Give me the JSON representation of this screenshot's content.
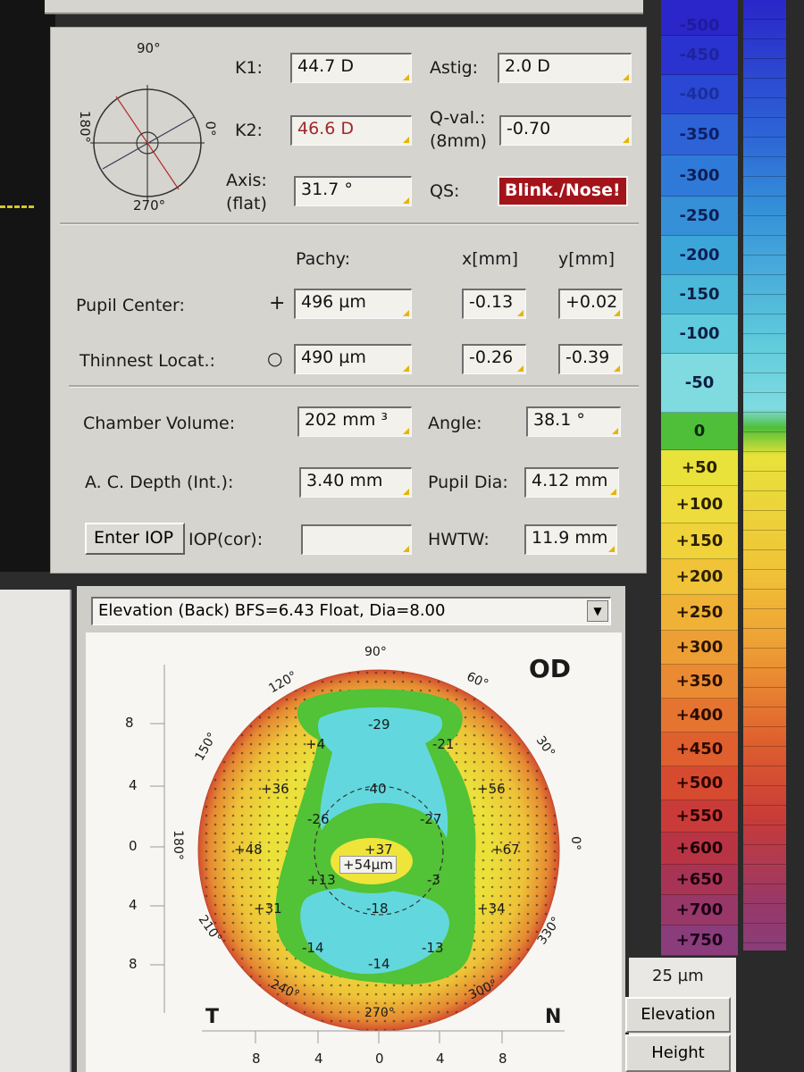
{
  "keratometry": {
    "k1_label": "K1:",
    "k1_value": "44.7 D",
    "k2_label": "K2:",
    "k2_value": "46.6 D",
    "axis_label_1": "Axis:",
    "axis_label_2": "(flat)",
    "axis_value": "31.7 °",
    "astig_label": "Astig:",
    "astig_value": "2.0 D",
    "qval_label_1": "Q-val.:",
    "qval_label_2": "(8mm)",
    "qval_value": "-0.70",
    "qs_label": "QS:",
    "qs_value": "Blink./Nose!",
    "dial_90": "90°",
    "dial_180": "180°",
    "dial_0": "0°",
    "dial_270": "270°"
  },
  "pachy": {
    "header_pachy": "Pachy:",
    "header_x": "x[mm]",
    "header_y": "y[mm]",
    "pupil_label": "Pupil Center:",
    "pupil_marker": "+",
    "pupil_pachy": "496 µm",
    "pupil_x": "-0.13",
    "pupil_y": "+0.02",
    "thin_label": "Thinnest Locat.:",
    "thin_marker": "○",
    "thin_pachy": "490 µm",
    "thin_x": "-0.26",
    "thin_y": "-0.39"
  },
  "chamber": {
    "volume_label": "Chamber Volume:",
    "volume_value": "202 mm ³",
    "angle_label": "Angle:",
    "angle_value": "38.1 °",
    "depth_label": "A. C. Depth (Int.):",
    "depth_value": "3.40 mm",
    "pupil_dia_label": "Pupil Dia:",
    "pupil_dia_value": "4.12 mm",
    "enter_iop": "Enter IOP",
    "iop_cor_label": "IOP(cor):",
    "iop_cor_value": "",
    "hwtw_label": "HWTW:",
    "hwtw_value": "11.9 mm"
  },
  "map": {
    "dropdown_value": "Elevation (Back)  BFS=6.43 Float, Dia=8.00",
    "eye": "OD",
    "temporal": "T",
    "nasal": "N",
    "angle_labels": [
      "90°",
      "60°",
      "30°",
      "0°",
      "330°",
      "300°",
      "270°",
      "240°",
      "210°",
      "180°",
      "150°",
      "120°"
    ],
    "y_ticks": [
      "8",
      "4",
      "0",
      "4",
      "8"
    ],
    "x_ticks": [
      "8",
      "4",
      "0",
      "4",
      "8"
    ],
    "values": [
      {
        "text": "-29"
      },
      {
        "text": "+4"
      },
      {
        "text": "-21"
      },
      {
        "text": "+36"
      },
      {
        "text": "-40"
      },
      {
        "text": "+56"
      },
      {
        "text": "-26"
      },
      {
        "text": "-27"
      },
      {
        "text": "+48"
      },
      {
        "text": "+37"
      },
      {
        "text": "+67"
      },
      {
        "text": "+13"
      },
      {
        "text": "-3"
      },
      {
        "text": "+31"
      },
      {
        "text": "-18"
      },
      {
        "text": "+34"
      },
      {
        "text": "-14"
      },
      {
        "text": "-13"
      },
      {
        "text": "-14"
      }
    ],
    "center_value": "+54µm"
  },
  "scale": {
    "items": [
      {
        "label": "-500",
        "color": "#2a26c9",
        "fg": "#1f1b9e"
      },
      {
        "label": "-450",
        "color": "#2a33cf",
        "fg": "#1e239e"
      },
      {
        "label": "-400",
        "color": "#2b48d4",
        "fg": "#1a2fa0"
      },
      {
        "label": "-350",
        "color": "#2d63d6",
        "fg": "#0d1e66"
      },
      {
        "label": "-300",
        "color": "#2f7ad9",
        "fg": "#0d1e55"
      },
      {
        "label": "-250",
        "color": "#3590d8",
        "fg": "#0d1e55"
      },
      {
        "label": "-200",
        "color": "#3da6d8",
        "fg": "#0d1e55"
      },
      {
        "label": "-150",
        "color": "#4cb9da",
        "fg": "#0d1e44"
      },
      {
        "label": "-100",
        "color": "#5fcbdc",
        "fg": "#0d1e44"
      },
      {
        "label": "-50",
        "color": "#7fdbe0",
        "fg": "#0d1e44"
      },
      {
        "label": "0",
        "color": "#4fbf3a",
        "fg": "#0d2a0d"
      },
      {
        "label": "+50",
        "color": "#e9e23a",
        "fg": "#2a2000"
      },
      {
        "label": "+100",
        "color": "#eedc3c",
        "fg": "#2a2000"
      },
      {
        "label": "+150",
        "color": "#f0d23a",
        "fg": "#2a2000"
      },
      {
        "label": "+200",
        "color": "#f0c338",
        "fg": "#2a2000"
      },
      {
        "label": "+250",
        "color": "#efb236",
        "fg": "#2a1800"
      },
      {
        "label": "+300",
        "color": "#ee9f34",
        "fg": "#2a1400"
      },
      {
        "label": "+350",
        "color": "#ea8a32",
        "fg": "#2a1000"
      },
      {
        "label": "+400",
        "color": "#e57430",
        "fg": "#2a0c00"
      },
      {
        "label": "+450",
        "color": "#df5f2e",
        "fg": "#2a0800"
      },
      {
        "label": "+500",
        "color": "#d64a30",
        "fg": "#2a0500"
      },
      {
        "label": "+550",
        "color": "#c83b38",
        "fg": "#2a0000"
      },
      {
        "label": "+600",
        "color": "#b83445",
        "fg": "#1a0000"
      },
      {
        "label": "+650",
        "color": "#a83455",
        "fg": "#1a0010"
      },
      {
        "label": "+700",
        "color": "#983868",
        "fg": "#1a0015"
      },
      {
        "label": "+750",
        "color": "#8a3d7a",
        "fg": "#1a0018"
      }
    ],
    "step_label": "25 µm",
    "button_1": "Elevation",
    "button_2": "Height"
  },
  "colors": {
    "panel": "#d6d4cf",
    "qs_red": "#a3141a",
    "k2_text": "#a0282d"
  }
}
